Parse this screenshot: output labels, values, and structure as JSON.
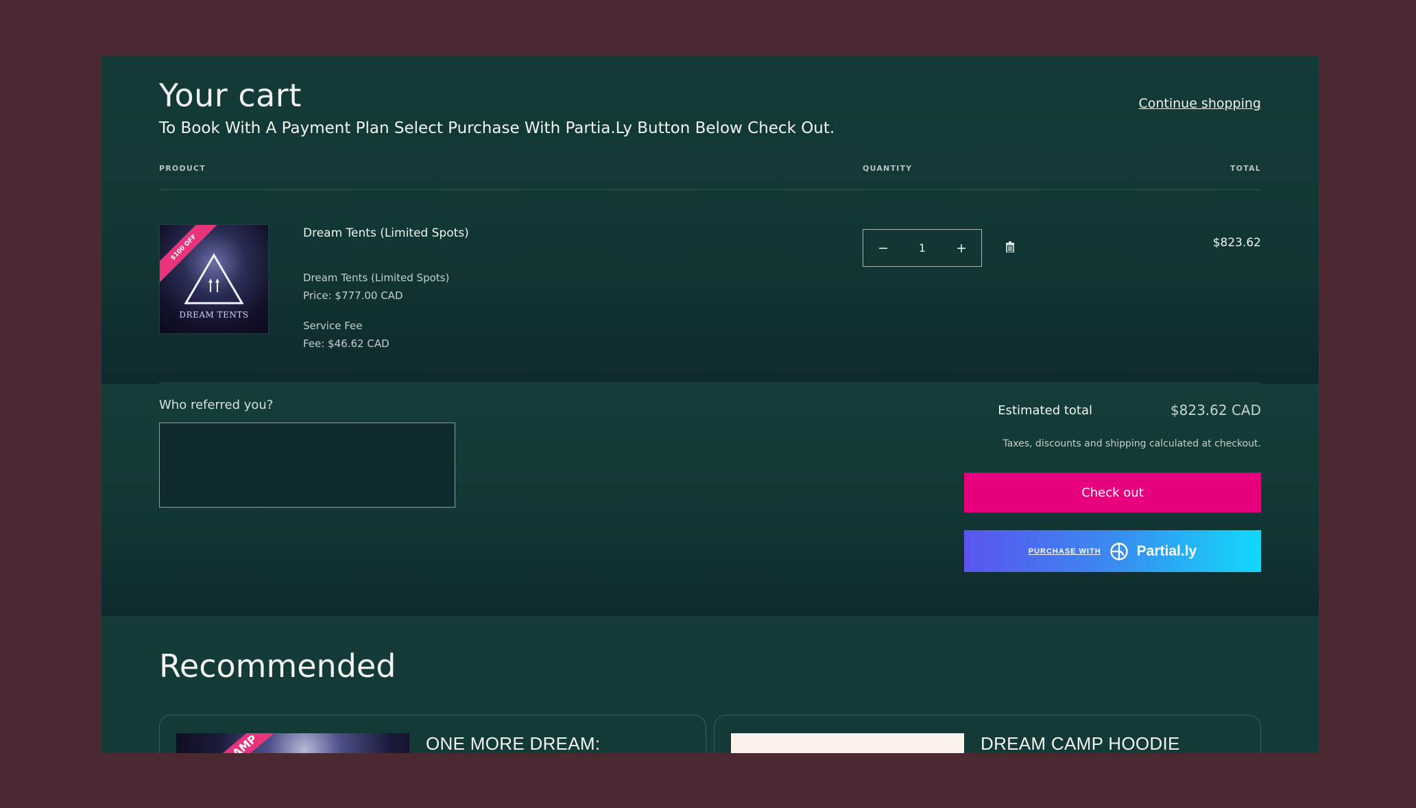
{
  "header": {
    "title": "Your cart",
    "subtitle": "To Book With A Payment Plan Select Purchase With Partia.Ly Button Below Check Out.",
    "continue_label": "Continue shopping"
  },
  "table": {
    "col_product": "PRODUCT",
    "col_quantity": "QUANTITY",
    "col_total": "TOTAL"
  },
  "item": {
    "badge": "$100 OFF",
    "image_text": "DREAM TENTS",
    "name": "Dream Tents (Limited Spots)",
    "option_name": "Dream Tents (Limited Spots)",
    "option_price": "Price: $777.00 CAD",
    "fee_name": "Service Fee",
    "fee_value": "Fee: $46.62 CAD",
    "quantity": "1",
    "total": "$823.62"
  },
  "summary": {
    "referral_label": "Who referred you?",
    "estimated_label": "Estimated total",
    "estimated_value": "$823.62 CAD",
    "tax_note": "Taxes, discounts and shipping calculated at checkout.",
    "checkout_label": "Check out",
    "partially_prefix": "PURCHASE WITH",
    "partially_brand": "Partial.ly"
  },
  "recommended": {
    "title": "Recommended",
    "items": [
      {
        "name": "ONE MORE DREAM:",
        "badge": "AMP"
      },
      {
        "name": "DREAM CAMP HOODIE"
      }
    ]
  },
  "colors": {
    "page_bg": "#4a2a30",
    "panel_bg": "#133a37",
    "checkout": "#e6007e",
    "partially_start": "#5a55ef",
    "partially_end": "#12d9fb"
  },
  "icons": [
    "minus-icon",
    "plus-icon",
    "trash-icon",
    "partially-logo-icon"
  ]
}
